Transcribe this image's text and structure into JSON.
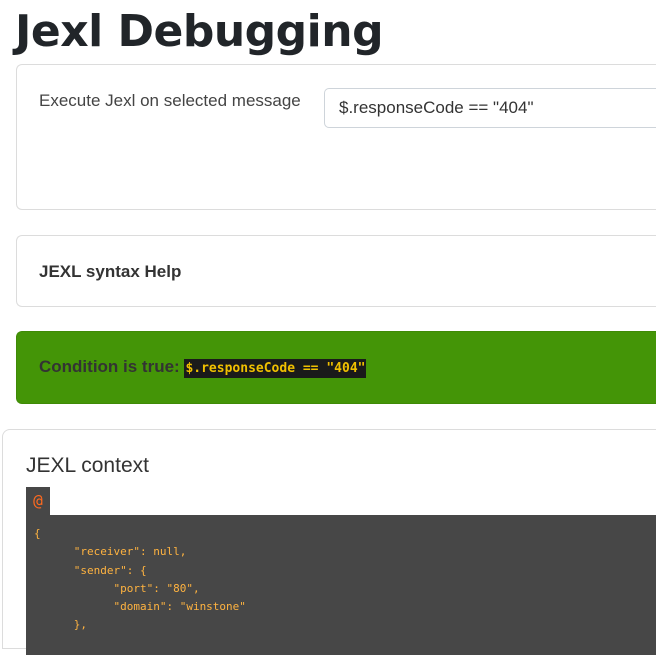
{
  "page": {
    "title": "Jexl Debugging"
  },
  "execute": {
    "label": "Execute Jexl on selected message",
    "input_value": "$.responseCode == \"404\""
  },
  "help": {
    "title": "JEXL syntax Help"
  },
  "result": {
    "prefix": "Condition is true:",
    "expression": "$.responseCode == \"404\"",
    "status_color": "#449507"
  },
  "context": {
    "title": "JEXL context",
    "root_symbol": "@",
    "json_lines": [
      "{",
      "      \"receiver\": null,",
      "      \"sender\": {",
      "            \"port\": \"80\",",
      "            \"domain\": \"winstone\"",
      "      },"
    ]
  }
}
